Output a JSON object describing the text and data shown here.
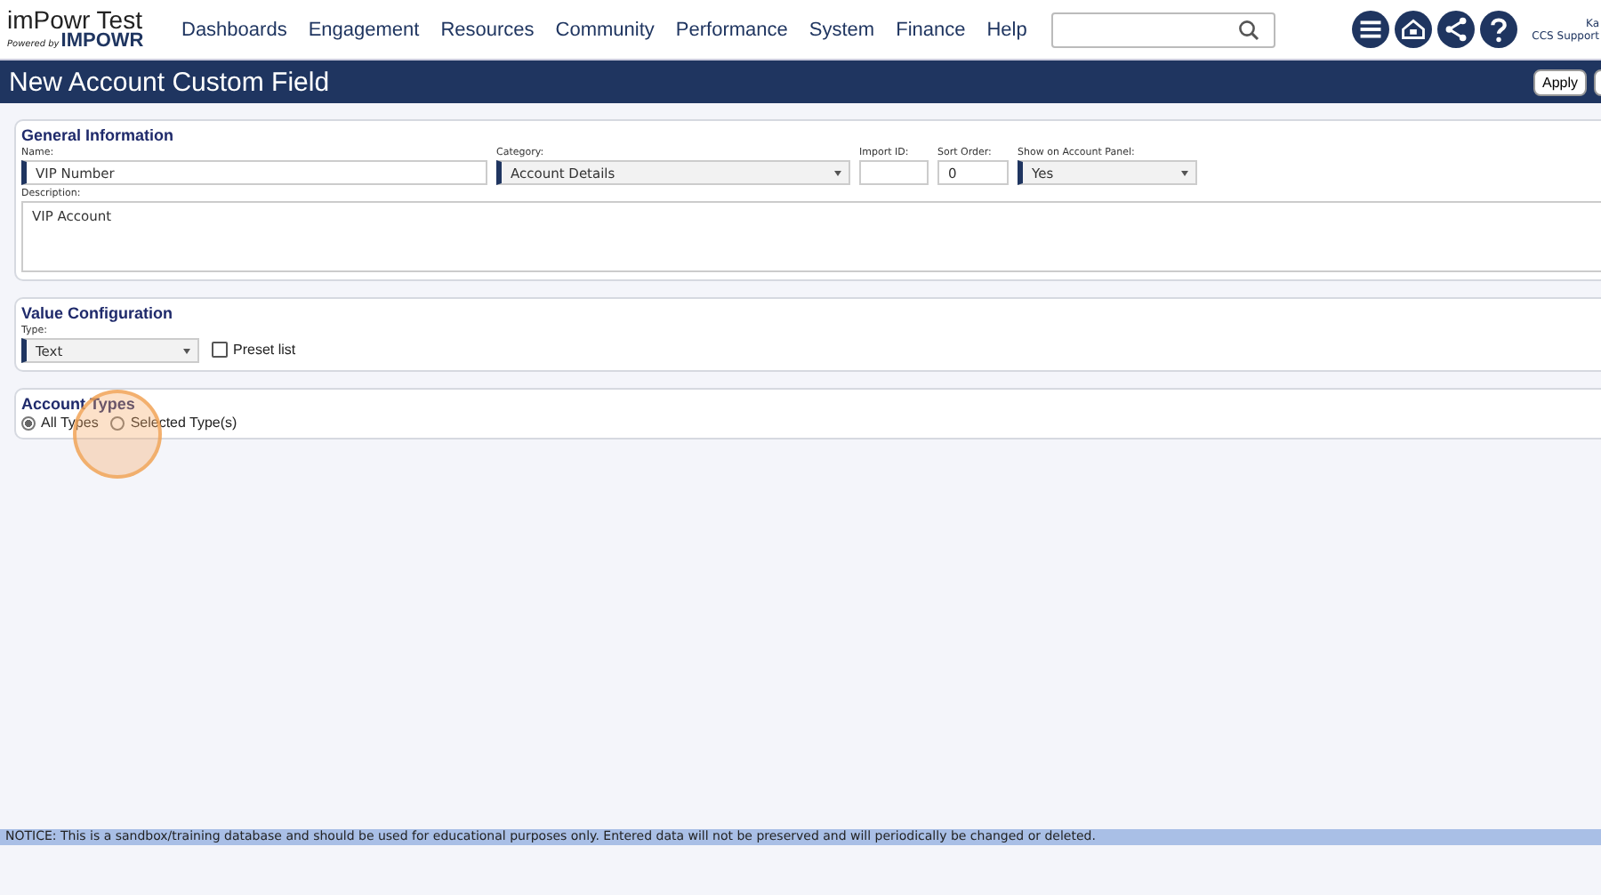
{
  "logo": {
    "title": "imPowr Test",
    "powered": "Powered by",
    "brand": "IMPOWR"
  },
  "nav": [
    "Dashboards",
    "Engagement",
    "Resources",
    "Community",
    "Performance",
    "System",
    "Finance",
    "Help"
  ],
  "user": {
    "name": "Ka",
    "org": "CCS Support"
  },
  "page_title": "New Account Custom Field",
  "actions": [
    "Apply"
  ],
  "general": {
    "title": "General Information",
    "fields": [
      {
        "label": "Name:",
        "value": "VIP Number",
        "kind": "text",
        "required": true
      },
      {
        "label": "Category:",
        "value": "Account Details",
        "kind": "select",
        "required": true
      },
      {
        "label": "Import ID:",
        "kind": "text",
        "required": false
      },
      {
        "label": "Sort Order:",
        "value": "0",
        "kind": "text",
        "required": false
      },
      {
        "label": "Show on Account Panel:",
        "value": "Yes",
        "kind": "select",
        "required": true
      }
    ],
    "description": {
      "label": "Description:",
      "value": "VIP Account"
    }
  },
  "value_config": {
    "title": "Value Configuration",
    "type": {
      "label": "Type:",
      "value": "Text"
    },
    "preset": {
      "label": "Preset list",
      "checked": false
    }
  },
  "account_types": {
    "title": "Account Types",
    "options": [
      {
        "label": "All Types",
        "selected": true
      },
      {
        "label": "Selected Type(s)",
        "selected": false
      }
    ]
  },
  "notice": "NOTICE: This is a sandbox/training database and should be used for educational purposes only. Entered data will not be preserved and will periodically be changed or deleted."
}
